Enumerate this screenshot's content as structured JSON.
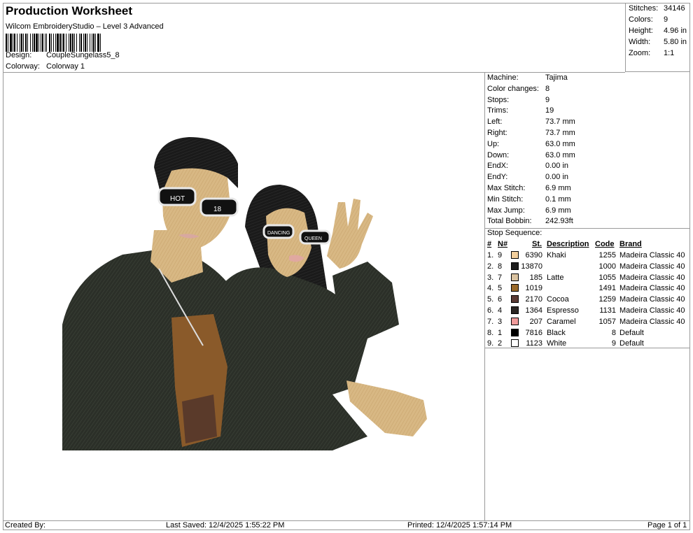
{
  "header": {
    "title": "Production Worksheet",
    "subtitle": "Wilcom EmbroideryStudio – Level 3 Advanced",
    "design_label": "Design:",
    "design_value": "CoupleSungelass5_8",
    "colorway_label": "Colorway:",
    "colorway_value": "Colorway 1"
  },
  "stats": [
    {
      "label": "Stitches:",
      "value": "34146"
    },
    {
      "label": "Colors:",
      "value": "9"
    },
    {
      "label": "Height:",
      "value": "4.96 in"
    },
    {
      "label": "Width:",
      "value": "5.80 in"
    },
    {
      "label": "Zoom:",
      "value": "1:1"
    }
  ],
  "machine_info": [
    {
      "label": "Machine:",
      "value": "Tajima"
    },
    {
      "label": "Color changes:",
      "value": "8"
    },
    {
      "label": "Stops:",
      "value": "9"
    },
    {
      "label": "Trims:",
      "value": "19"
    },
    {
      "label": "Left:",
      "value": "73.7 mm"
    },
    {
      "label": "Right:",
      "value": "73.7 mm"
    },
    {
      "label": "Up:",
      "value": "63.0 mm"
    },
    {
      "label": "Down:",
      "value": "63.0 mm"
    },
    {
      "label": "EndX:",
      "value": "0.00 in"
    },
    {
      "label": "EndY:",
      "value": "0.00 in"
    },
    {
      "label": "Max Stitch:",
      "value": "6.9 mm"
    },
    {
      "label": "Min Stitch:",
      "value": "0.1 mm"
    },
    {
      "label": "Max Jump:",
      "value": "6.9 mm"
    },
    {
      "label": "Total Bobbin:",
      "value": "242.93ft"
    }
  ],
  "stop_sequence": {
    "heading": "Stop Sequence:",
    "columns": {
      "num": "#",
      "n": "N#",
      "st": "St.",
      "desc": "Description",
      "code": "Code",
      "brand": "Brand"
    },
    "rows": [
      {
        "num": "1.",
        "n": "9",
        "color": "#f3cf9c",
        "st": "6390",
        "desc": "Khaki",
        "code": "1255",
        "brand": "Madeira Classic 40"
      },
      {
        "num": "2.",
        "n": "8",
        "color": "#1d1d1d",
        "st": "13870",
        "desc": "",
        "code": "1000",
        "brand": "Madeira Classic 40"
      },
      {
        "num": "3.",
        "n": "7",
        "color": "#d9c2a0",
        "st": "185",
        "desc": "Latte",
        "code": "1055",
        "brand": "Madeira Classic 40"
      },
      {
        "num": "4.",
        "n": "5",
        "color": "#9a6a2a",
        "st": "1019",
        "desc": "",
        "code": "1491",
        "brand": "Madeira Classic 40"
      },
      {
        "num": "5.",
        "n": "6",
        "color": "#5a3a34",
        "st": "2170",
        "desc": "Cocoa",
        "code": "1259",
        "brand": "Madeira Classic 40"
      },
      {
        "num": "6.",
        "n": "4",
        "color": "#2a2522",
        "st": "1364",
        "desc": "Espresso",
        "code": "1131",
        "brand": "Madeira Classic 40"
      },
      {
        "num": "7.",
        "n": "3",
        "color": "#ef9a9a",
        "st": "207",
        "desc": "Caramel",
        "code": "1057",
        "brand": "Madeira Classic 40"
      },
      {
        "num": "8.",
        "n": "1",
        "color": "#000000",
        "st": "7816",
        "desc": "Black",
        "code": "8",
        "brand": "Default"
      },
      {
        "num": "9.",
        "n": "2",
        "color": "#ffffff",
        "st": "1123",
        "desc": "White",
        "code": "9",
        "brand": "Default"
      }
    ]
  },
  "artwork": {
    "glasses_left_text_1": "HOT",
    "glasses_left_text_2": "18",
    "glasses_right_text_1": "DANCING",
    "glasses_right_text_2": "QUEEN"
  },
  "footer": {
    "created_by": "Created By:",
    "last_saved": "Last Saved: 12/4/2025 1:55:22 PM",
    "printed": "Printed: 12/4/2025 1:57:14 PM",
    "page": "Page 1 of 1"
  }
}
